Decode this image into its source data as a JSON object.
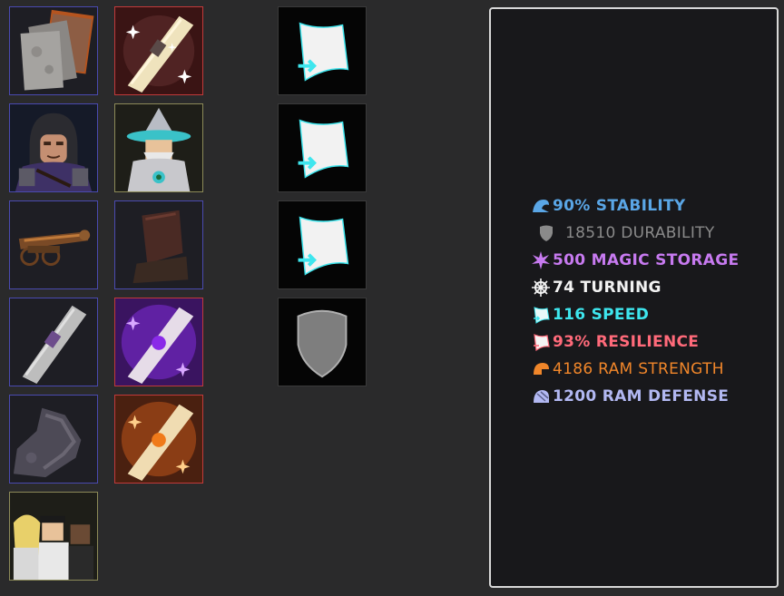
{
  "inventory": {
    "column1": [
      {
        "name": "stone-plating-item",
        "rarity": "blue"
      },
      {
        "name": "hooded-rogue-crew",
        "rarity": "blue"
      },
      {
        "name": "bronze-cannon-item",
        "rarity": "blue"
      },
      {
        "name": "gray-scroll-item",
        "rarity": "blue"
      },
      {
        "name": "rock-ram-item",
        "rarity": "blue"
      },
      {
        "name": "crew-trio-item",
        "rarity": "olive"
      }
    ],
    "column2": [
      {
        "name": "sparkle-scroll-item",
        "rarity": "red"
      },
      {
        "name": "wizard-crew",
        "rarity": "olive"
      },
      {
        "name": "dark-cannon-item",
        "rarity": "blue"
      },
      {
        "name": "purple-scroll-item",
        "rarity": "red"
      },
      {
        "name": "orange-scroll-item",
        "rarity": "red"
      }
    ],
    "column3": [
      {
        "name": "sail-boost-icon"
      },
      {
        "name": "sail-boost-icon"
      },
      {
        "name": "sail-boost-icon"
      },
      {
        "name": "shield-slot-icon"
      }
    ]
  },
  "stats": [
    {
      "icon": "wave-icon",
      "text": "90% STABILITY",
      "color": "#5aa6e6"
    },
    {
      "icon": "shield-icon",
      "text": "18510 DURABILITY",
      "color": "#8a8a8a"
    },
    {
      "icon": "star-burst-icon",
      "text": "500 MAGIC STORAGE",
      "color": "#c77af0"
    },
    {
      "icon": "ship-wheel-icon",
      "text": "74 TURNING",
      "color": "#f2f2f2"
    },
    {
      "icon": "sail-icon",
      "text": "116 SPEED",
      "color": "#3ee6ee"
    },
    {
      "icon": "sail-outline-icon",
      "text": "93% RESILIENCE",
      "color": "#ff6a7a"
    },
    {
      "icon": "ram-icon",
      "text": "4186 RAM STRENGTH",
      "color": "#f0862a"
    },
    {
      "icon": "armor-icon",
      "text": "1200 RAM DEFENSE",
      "color": "#b2b8f2"
    }
  ]
}
